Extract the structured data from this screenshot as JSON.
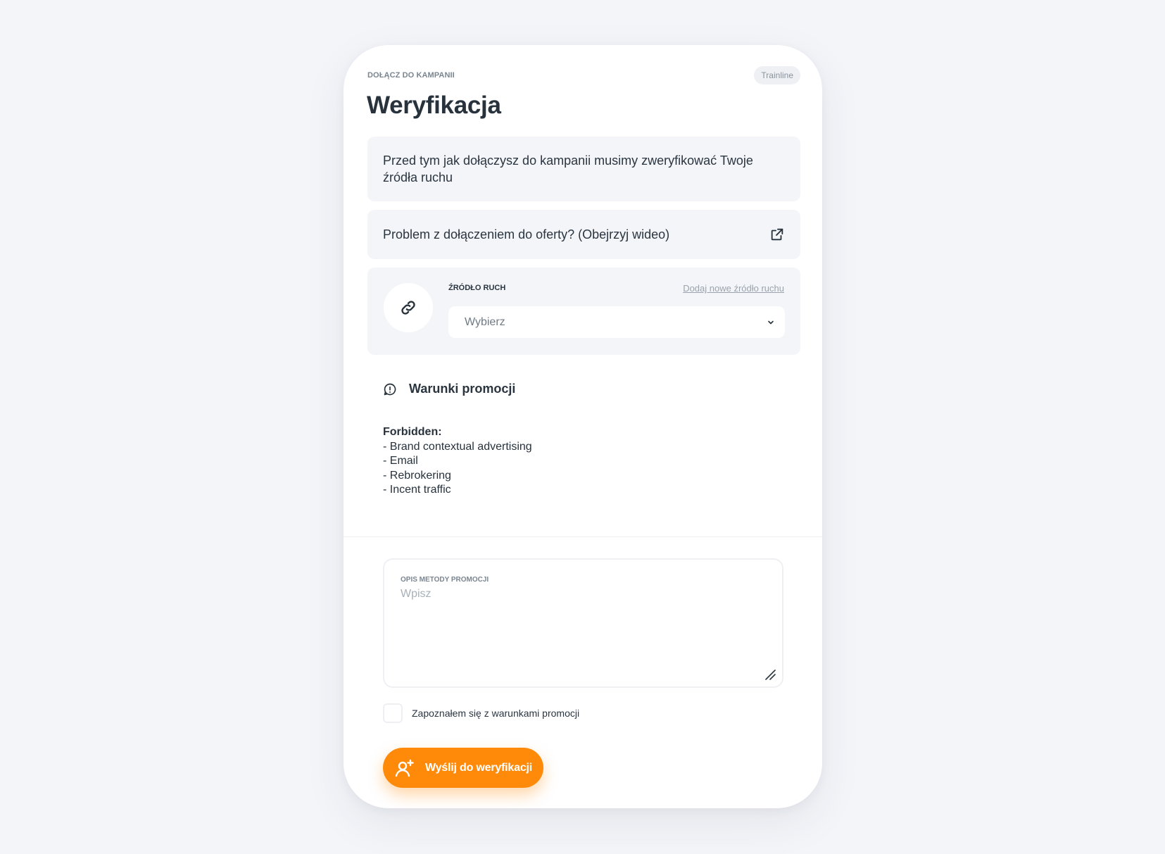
{
  "header": {
    "eyebrow": "DOŁĄCZ DO KAMPANII",
    "brand": "Trainline",
    "title": "Weryfikacja"
  },
  "info": {
    "text": "Przed tym jak dołączysz do kampanii musimy zweryfikować Twoje źródła ruchu"
  },
  "video": {
    "text": "Problem z dołączeniem do oferty? (Obejrzyj wideo)",
    "icon": "external-link-icon"
  },
  "source": {
    "label": "ŹRÓDŁO RUCH",
    "add_link": "Dodaj nowe źródło ruchu",
    "select_value": "Wybierz",
    "icon": "link-icon"
  },
  "conditions": {
    "title": "Warunki promocji",
    "icon": "alert-circle-icon",
    "heading": "Forbidden:",
    "items": [
      "- Brand contextual advertising",
      "- Email",
      "- Rebrokering",
      "- Incent traffic"
    ]
  },
  "description": {
    "label": "OPIS METODY PROMOCJI",
    "placeholder": "Wpisz"
  },
  "agreement": {
    "label": "Zapoznałem się z warunkami promocji"
  },
  "submit": {
    "label": "Wyślij do weryfikacji",
    "icon": "user-plus-icon"
  },
  "colors": {
    "accent": "#ff8a0a",
    "background": "#f4f5f9",
    "panel": "#f4f5f9",
    "text": "#2a3540"
  }
}
